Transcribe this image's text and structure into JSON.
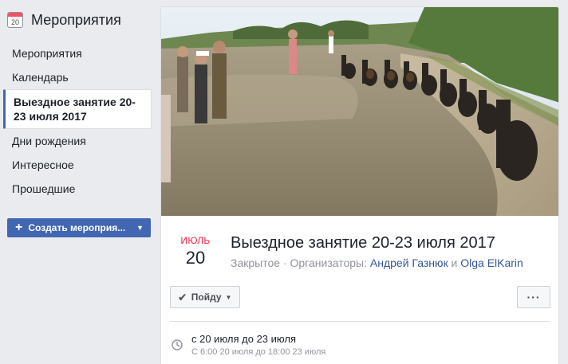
{
  "sidebar": {
    "title": "Мероприятия",
    "calendar_icon_day": "20",
    "items": [
      {
        "label": "Мероприятия"
      },
      {
        "label": "Календарь"
      },
      {
        "label": "Выездное занятие 20-23 июля 2017"
      },
      {
        "label": "Дни рождения"
      },
      {
        "label": "Интересное"
      },
      {
        "label": "Прошедшие"
      }
    ],
    "create_button": "Создать мероприя..."
  },
  "event": {
    "month": "Июль",
    "day": "20",
    "title": "Выездное занятие 20-23 июля 2017",
    "privacy": "Закрытое",
    "organizers_label": "Организаторы:",
    "organizer_1": "Андрей Газнюк",
    "and": "и",
    "organizer_2": "Olga ElKarin",
    "going_button": "Пойду",
    "more_button": "···",
    "time_main": "с 20 июля до 23 июля",
    "time_sub": "С 6:00 20 июля до 18:00 23 июля"
  },
  "colors": {
    "accent": "#4267b2",
    "link": "#385898",
    "month": "#f02849",
    "background": "#e9ebee"
  },
  "icons": {
    "calendar": "calendar-icon",
    "plus": "plus-icon",
    "check": "check-icon",
    "clock": "clock-icon"
  }
}
